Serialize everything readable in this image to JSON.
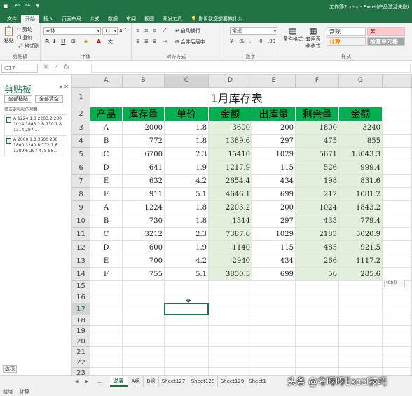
{
  "window": {
    "title": "工作簿2.xlsx - Excel(产品激活失败)"
  },
  "ribbon_tabs": [
    "文件",
    "开始",
    "插入",
    "页面布局",
    "公式",
    "数据",
    "审阅",
    "视图",
    "开发工具"
  ],
  "tell_me": "告诉我您想要做什么...",
  "ribbon": {
    "clipboard": {
      "paste": "粘贴",
      "cut": "剪切",
      "copy": "复制",
      "format_painter": "格式刷",
      "label": "剪贴板"
    },
    "font": {
      "name": "宋体",
      "size": "11",
      "label": "字体"
    },
    "alignment": {
      "wrap": "自动换行",
      "merge": "合并后居中",
      "label": "对齐方式"
    },
    "number": {
      "format": "常规",
      "label": "数字"
    },
    "styles": {
      "cond_format": "条件格式",
      "table_format": "套用表格格式",
      "normal": "常规",
      "bad": "差",
      "calc": "计算",
      "check": "检查单元格",
      "label": "样式"
    }
  },
  "formula_bar": {
    "name_box": "C17",
    "cancel": "✕",
    "enter": "✓",
    "fx": "fx"
  },
  "clipboard_pane": {
    "title": "剪贴板",
    "paste_all": "全部粘贴",
    "clear_all": "全部清空",
    "hint": "单击要粘贴的项目:",
    "items": [
      "A 1224 1.8 2203.2 200 1024 1843.2 B 730 1.8 1314 297 ...",
      "A 2000 1.8 3600 200 1800 3240 B 772 1.8 1389.6 297 475 85..."
    ],
    "options": "选项"
  },
  "columns": [
    "A",
    "B",
    "C",
    "D",
    "E",
    "F",
    "G"
  ],
  "rows": [
    "1",
    "2",
    "3",
    "4",
    "5",
    "6",
    "7",
    "8",
    "9",
    "10",
    "11",
    "12",
    "13",
    "14",
    "15",
    "16",
    "17",
    "18",
    "19",
    "20",
    "21",
    "22",
    "23",
    "24",
    "25"
  ],
  "sheet": {
    "title": "1月库存表",
    "headers": [
      "产品",
      "库存量",
      "单价",
      "金额",
      "出库量",
      "剩余量",
      "金额"
    ],
    "data": [
      [
        "A",
        "2000",
        "1.8",
        "3600",
        "200",
        "1800",
        "3240"
      ],
      [
        "B",
        "772",
        "1.8",
        "1389.6",
        "297",
        "475",
        "855"
      ],
      [
        "C",
        "6700",
        "2.3",
        "15410",
        "1029",
        "5671",
        "13043.3"
      ],
      [
        "D",
        "641",
        "1.9",
        "1217.9",
        "115",
        "526",
        "999.4"
      ],
      [
        "E",
        "632",
        "4.2",
        "2654.4",
        "434",
        "198",
        "831.6"
      ],
      [
        "F",
        "911",
        "5.1",
        "4646.1",
        "699",
        "212",
        "1081.2"
      ],
      [
        "A",
        "1224",
        "1.8",
        "2203.2",
        "200",
        "1024",
        "1843.2"
      ],
      [
        "B",
        "730",
        "1.8",
        "1314",
        "297",
        "433",
        "779.4"
      ],
      [
        "C",
        "3212",
        "2.3",
        "7387.6",
        "1029",
        "2183",
        "5020.9"
      ],
      [
        "D",
        "600",
        "1.9",
        "1140",
        "115",
        "485",
        "921.5"
      ],
      [
        "E",
        "700",
        "4.2",
        "2940",
        "434",
        "266",
        "1117.2"
      ],
      [
        "F",
        "755",
        "5.1",
        "3850.5",
        "699",
        "56",
        "285.6"
      ]
    ],
    "paste_tag": "(Ctrl)"
  },
  "sheet_tabs": [
    "总表",
    "A组",
    "B组",
    "Sheet127",
    "Sheet128",
    "Sheet129",
    "Sheet1"
  ],
  "status": [
    "就绪",
    "计算"
  ],
  "watermark": "头条 @考呀呀Excel技巧",
  "colors": {
    "accent": "#217346",
    "header_fill": "#00b050",
    "highlight": "#e2efda"
  }
}
